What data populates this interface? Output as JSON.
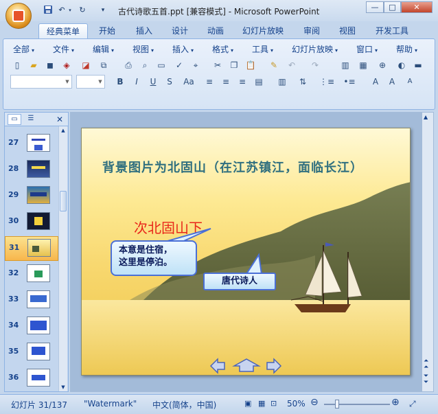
{
  "window": {
    "title": "古代诗歌五首.ppt [兼容模式] - Microsoft PowerPoint",
    "controls": {
      "minimize": "—",
      "maximize": "□",
      "close": "✕"
    }
  },
  "quick_access": {
    "save": "save-icon",
    "undo": "undo-icon",
    "redo": "redo-icon",
    "customize": "▾"
  },
  "tabs": [
    "经典菜单",
    "开始",
    "插入",
    "设计",
    "动画",
    "幻灯片放映",
    "审阅",
    "视图",
    "开发工具"
  ],
  "active_tab": "经典菜单",
  "menu": [
    "全部",
    "文件",
    "编辑",
    "视图",
    "插入",
    "格式",
    "工具",
    "幻灯片放映",
    "窗口",
    "帮助"
  ],
  "format_buttons": {
    "bold": "B",
    "italic": "I",
    "underline": "U",
    "strike": "S",
    "case": "Aa"
  },
  "slides_panel": {
    "close_label": "✕",
    "items": [
      {
        "num": "27"
      },
      {
        "num": "28"
      },
      {
        "num": "29"
      },
      {
        "num": "30"
      },
      {
        "num": "31"
      },
      {
        "num": "32"
      },
      {
        "num": "33"
      },
      {
        "num": "34"
      },
      {
        "num": "35"
      },
      {
        "num": "36"
      }
    ],
    "selected": "31"
  },
  "slide": {
    "title": "背景图片为北固山（在江苏镇江，面临长江）",
    "poem_title": "次北固山下",
    "callout1": [
      "本意是住宿，",
      "这里是停泊。"
    ],
    "callout2": "唐代诗人",
    "nav": {
      "prev": "prev-arrow-icon",
      "home": "home-arrow-icon",
      "next": "next-arrow-icon"
    }
  },
  "status": {
    "slide_info": "幻灯片 31/137",
    "theme": "\"Watermark\"",
    "language": "中文(简体，中国)",
    "zoom": "50%"
  },
  "colors": {
    "accent": "#15428b",
    "ribbon": "#d6e4f5",
    "slide_title": "#2f6f7f",
    "poem_title": "#e8261a"
  }
}
